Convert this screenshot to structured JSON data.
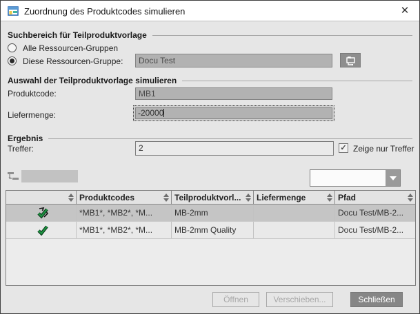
{
  "window": {
    "title": "Zuordnung des Produktcodes simulieren",
    "close_glyph": "✕"
  },
  "sections": {
    "search": {
      "title": "Suchbereich für Teilproduktvorlage",
      "radio_all_label": "Alle Ressourcen-Gruppen",
      "radio_this_label": "Diese Ressourcen-Gruppe:",
      "group_value": "Docu Test"
    },
    "selection": {
      "title": "Auswahl der Teilproduktvorlage simulieren",
      "productcode_label": "Produktcode:",
      "productcode_value": "MB1",
      "quantity_label": "Liefermenge:",
      "quantity_value": "-20000"
    },
    "result": {
      "title": "Ergebnis",
      "hits_label": "Treffer:",
      "hits_value": "2",
      "checkbox_glyph": "✓",
      "checkbox_label": "Zeige nur Treffer"
    }
  },
  "table": {
    "columns": [
      "",
      "Produktcodes",
      "Teilproduktvorl...",
      "Liefermenge",
      "Pfad"
    ],
    "rows": [
      {
        "icon": "check-modified-icon",
        "productcodes": "*MB1*, *MB2*, *M...",
        "template": "MB-2mm",
        "liefermenge": "",
        "pfad": "Docu Test/MB-2..."
      },
      {
        "icon": "check-icon",
        "productcodes": "*MB1*, *MB2*, *M...",
        "template": "MB-2mm Quality",
        "liefermenge": "",
        "pfad": "Docu Test/MB-2..."
      }
    ]
  },
  "buttons": {
    "open": "Öffnen",
    "move": "Verschieben...",
    "close": "Schließen"
  },
  "colors": {
    "field_gray": "#b2b2b2",
    "selected_row": "#c5c5c5",
    "primary_button": "#868686",
    "check_green": "#1d9140"
  }
}
